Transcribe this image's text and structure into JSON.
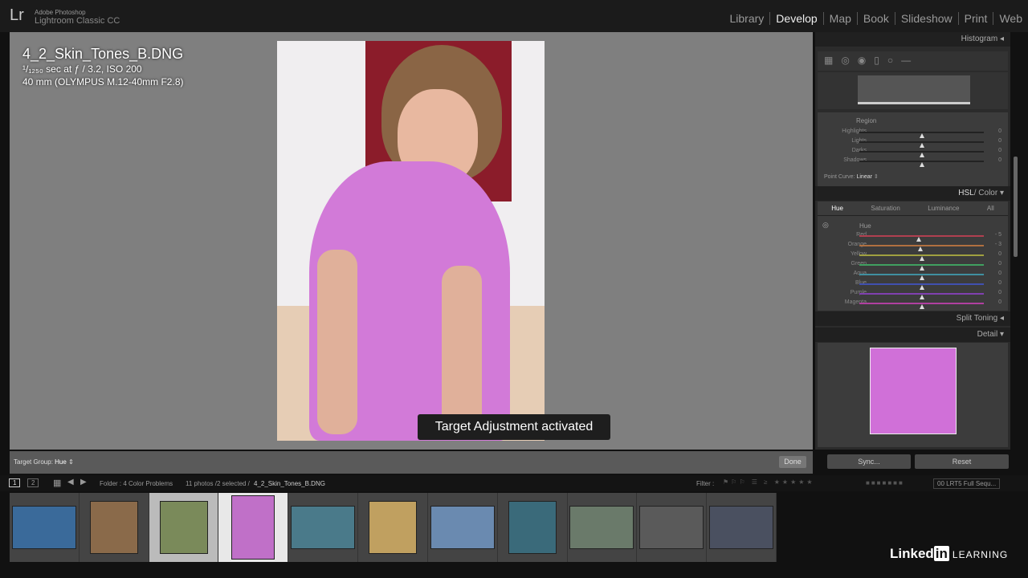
{
  "app": {
    "brand_line1": "Adobe Photoshop",
    "brand_line2": "Lightroom Classic CC",
    "logo": "Lr"
  },
  "modules": [
    "Library",
    "Develop",
    "Map",
    "Book",
    "Slideshow",
    "Print",
    "Web"
  ],
  "active_module": "Develop",
  "photo_info": {
    "filename": "4_2_Skin_Tones_B.DNG",
    "exposure": "¹/₁₂₅₀ sec at ƒ / 3.2, ISO 200",
    "lens": "40 mm (OLYMPUS M.12-40mm F2.8)"
  },
  "toast": "Target Adjustment activated",
  "toolbar": {
    "target_group_label": "Target Group:",
    "target_group_value": "Hue",
    "done": "Done"
  },
  "panels": {
    "histogram": "Histogram",
    "tone_curve": {
      "region": "Region",
      "sliders": [
        {
          "label": "Highlights",
          "value": "0"
        },
        {
          "label": "Lights",
          "value": "0"
        },
        {
          "label": "Darks",
          "value": "0"
        },
        {
          "label": "Shadows",
          "value": "0"
        }
      ],
      "point_curve_label": "Point Curve:",
      "point_curve_value": "Linear"
    },
    "hsl": {
      "title_a": "HSL",
      "title_b": "/ Color",
      "tabs": [
        "Hue",
        "Saturation",
        "Luminance",
        "All"
      ],
      "active_tab": "Hue",
      "group": "Hue",
      "sliders": [
        {
          "label": "Red",
          "value": "- 5",
          "pos": 0.48,
          "color": "#b04050"
        },
        {
          "label": "Orange",
          "value": "- 3",
          "pos": 0.49,
          "color": "#b07040"
        },
        {
          "label": "Yellow",
          "value": "0",
          "pos": 0.5,
          "color": "#a0a040"
        },
        {
          "label": "Green",
          "value": "0",
          "pos": 0.5,
          "color": "#40a060"
        },
        {
          "label": "Aqua",
          "value": "0",
          "pos": 0.5,
          "color": "#4090a0"
        },
        {
          "label": "Blue",
          "value": "0",
          "pos": 0.5,
          "color": "#4050b0"
        },
        {
          "label": "Purple",
          "value": "0",
          "pos": 0.5,
          "color": "#8040b0"
        },
        {
          "label": "Magenta",
          "value": "0",
          "pos": 0.5,
          "color": "#b040a0"
        }
      ]
    },
    "split_toning": "Split Toning",
    "detail": "Detail",
    "sync": "Sync...",
    "reset": "Reset"
  },
  "filmstrip_bar": {
    "view1": "1",
    "view2": "2",
    "folder": "Folder : 4 Color Problems",
    "count": "11 photos /2 selected /",
    "current": "4_2_Skin_Tones_B.DNG",
    "filter_label": "Filter :",
    "filter_preset": "00 LRT5 Full Sequ..."
  },
  "thumbnails": [
    {
      "c": "#3a6a9a"
    },
    {
      "c": "#8a6a4a"
    },
    {
      "c": "#7a8a5a",
      "sel": true
    },
    {
      "c": "#c070c8",
      "cur": true
    },
    {
      "c": "#4a7a8a"
    },
    {
      "c": "#c0a060"
    },
    {
      "c": "#6a8ab0"
    },
    {
      "c": "#3a6a7a"
    },
    {
      "c": "#6a7a6a"
    },
    {
      "c": "#5a5a5a"
    },
    {
      "c": "#4a5060"
    }
  ],
  "watermark": {
    "linkedin": "Linked",
    "in": "in",
    "learning": "LEARNING"
  }
}
